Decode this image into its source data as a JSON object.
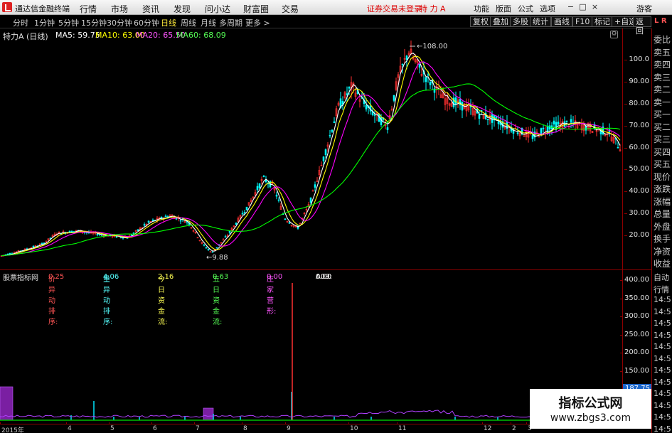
{
  "titlebar": {
    "app_title": "通达信金融终端",
    "menu": [
      "行情",
      "市场",
      "资讯",
      "发现",
      "问小达",
      "财富圈",
      "交易"
    ],
    "warning": "证券交易未登录",
    "stock": "特 力 A",
    "right_items": [
      "功能",
      "版面",
      "公式",
      "选项"
    ],
    "user": "游客",
    "window_buttons": [
      "−",
      "□",
      "×"
    ]
  },
  "period_tabs": [
    "分时",
    "1分钟",
    "5分钟",
    "15分钟",
    "30分钟",
    "60分钟",
    "日线",
    "周线",
    "月线",
    "多周期",
    "更多 >"
  ],
  "active_period": "日线",
  "right_tools": [
    "复权",
    "叠加",
    "多股",
    "统计",
    "画线",
    "F10",
    "标记",
    "+自选",
    "返回"
  ],
  "main_header": {
    "stock_label": "特力A (日线)",
    "ma5": "MA5: 59.75",
    "ma10": "MA10: 63.00",
    "ma20": "MA20: 65.50",
    "ma60": "MA60: 68.09"
  },
  "annotations": {
    "high": "108.00",
    "low": "9.88"
  },
  "price_axis": [
    "100.0",
    "90.00",
    "80.00",
    "70.00",
    "60.00",
    "50.00",
    "40.00",
    "30.00",
    "20.00"
  ],
  "indicator_header": {
    "name": "股票指标网",
    "items": [
      {
        "label": "价异动排序:",
        "value": "0.25",
        "color": "#ff5555"
      },
      {
        "label": "量异动排序:",
        "value": "4.06",
        "color": "#55ffff"
      },
      {
        "label": "今日资金流:",
        "value": "2.16",
        "color": "#ffff55"
      },
      {
        "label": "五日资金流:",
        "value": "0.63",
        "color": "#55ff55"
      },
      {
        "label": "庄家营形:",
        "value": "0.00",
        "color": "#ff55ff"
      },
      {
        "label": "A09:",
        "value": "0.00",
        "color": "#ffffff"
      }
    ]
  },
  "indicator_axis": [
    "400.00",
    "350.00",
    "300.00",
    "250.00",
    "200.00",
    "150.00",
    "100.00",
    "50.00"
  ],
  "indicator_price_tag": "187.75",
  "date_axis": [
    "2015年",
    "4",
    "5",
    "6",
    "7",
    "8",
    "9",
    "10",
    "11",
    "12",
    "2",
    "3"
  ],
  "side_panel": {
    "top": "L R",
    "items": [
      "委比",
      "卖五",
      "卖四",
      "卖三",
      "卖二",
      "卖一",
      "买一",
      "买二",
      "买三",
      "买四",
      "买五",
      "现价",
      "涨跌",
      "涨幅",
      "总量",
      "外盘",
      "换手",
      "净资",
      "收益"
    ],
    "bottom_items": [
      "自动",
      "行情",
      "14:5",
      "14:5",
      "14:5",
      "14:5",
      "14:5",
      "14:5",
      "14:5",
      "14:5",
      "14:5",
      "14:5",
      "14:5",
      "14:5"
    ]
  },
  "watermark": {
    "line1": "指标公式网",
    "line2": "www.zbgs3.com"
  },
  "colors": {
    "ma5": "#ffffff",
    "ma10": "#ffff00",
    "ma20": "#ff00ff",
    "ma60": "#00ff00",
    "up": "#ff3030",
    "down": "#00ffff"
  }
}
